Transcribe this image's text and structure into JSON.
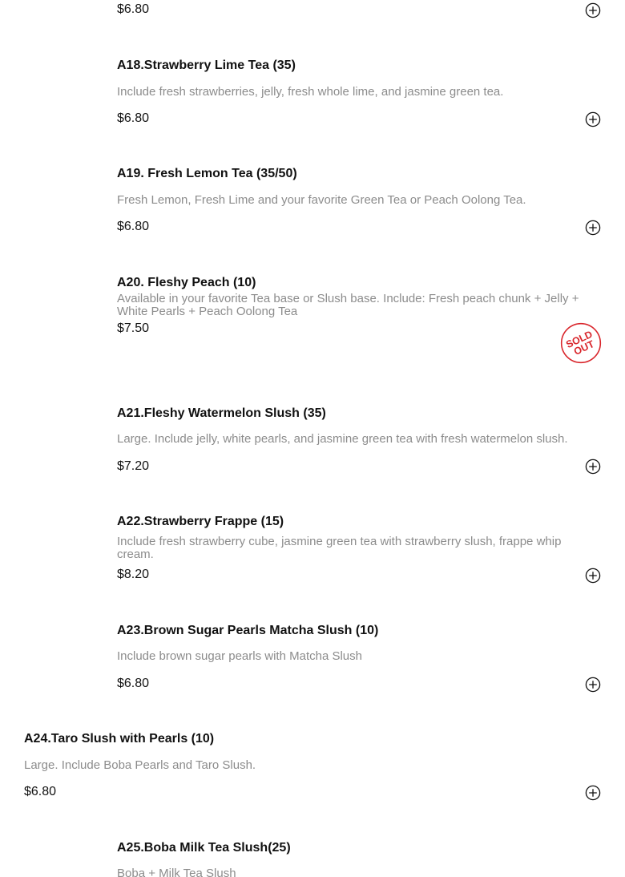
{
  "colors": {
    "name": "#111111",
    "description": "#8c8c8c",
    "price": "#111111",
    "add_icon": "#111111",
    "sold_out": "#d9262c"
  },
  "icons": {
    "add": "plus-circle-icon",
    "sold_out": "sold-out-stamp-icon"
  },
  "items": [
    {
      "price": "$6.80"
    },
    {
      "name": "A18.Strawberry Lime Tea (35)",
      "description": "Include fresh strawberries, jelly, fresh whole lime, and jasmine green tea.",
      "price": "$6.80"
    },
    {
      "name": "A19. Fresh Lemon Tea (35/50)",
      "description": "Fresh Lemon, Fresh Lime and your favorite Green Tea or Peach Oolong Tea.",
      "price": "$6.80"
    },
    {
      "name": "A20. Fleshy Peach (10)",
      "description": "Available in your favorite Tea base or Slush base. Include: Fresh peach chunk + Jelly + White Pearls + Peach Oolong Tea",
      "price": "$7.50",
      "sold_out_label": [
        "SOLD",
        "OUT"
      ]
    },
    {
      "name": "A21.Fleshy Watermelon Slush (35)",
      "description": "Large. Include jelly, white pearls, and jasmine green tea with fresh watermelon slush.",
      "price": "$7.20"
    },
    {
      "name": "A22.Strawberry Frappe (15)",
      "description": "Include fresh strawberry cube, jasmine green tea with strawberry slush, frappe whip cream.",
      "price": "$8.20"
    },
    {
      "name": "A23.Brown Sugar Pearls Matcha Slush (10)",
      "description": "Include brown sugar pearls with Matcha Slush",
      "price": "$6.80"
    },
    {
      "name": "A24.Taro Slush with Pearls (10)",
      "description": "Large. Include Boba Pearls and Taro Slush.",
      "price": "$6.80"
    },
    {
      "name": "A25.Boba Milk Tea Slush(25)",
      "description": "Boba + Milk Tea Slush"
    }
  ]
}
